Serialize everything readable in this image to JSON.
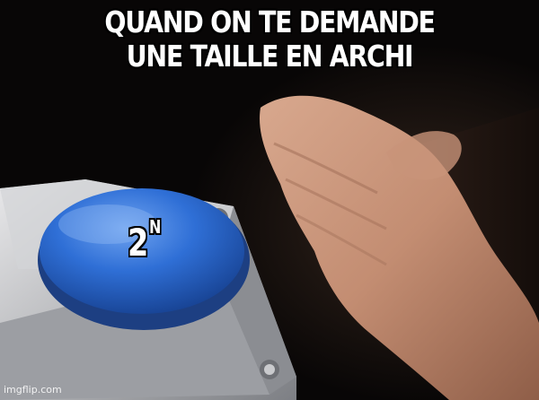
{
  "caption": {
    "line1": "QUAND ON TE DEMANDE",
    "line2": "UNE TAILLE EN ARCHI"
  },
  "button": {
    "base": "2",
    "exponent": "N",
    "color": "#2f6fd6"
  },
  "watermark": "imgflip.com"
}
